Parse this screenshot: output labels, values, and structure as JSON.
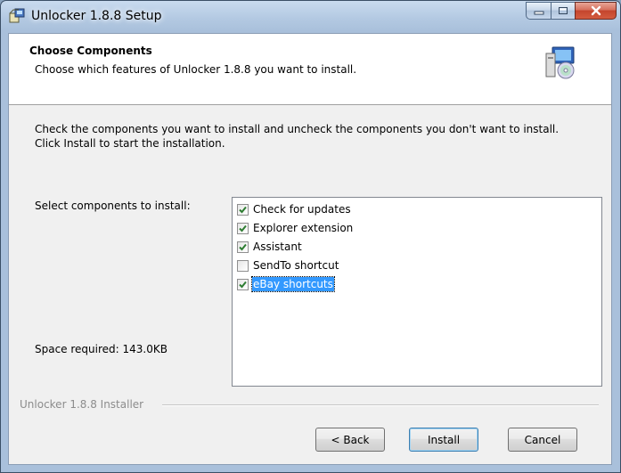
{
  "window": {
    "title": "Unlocker 1.8.8 Setup"
  },
  "header": {
    "title": "Choose Components",
    "subtitle": "Choose which features of Unlocker 1.8.8 you want to install."
  },
  "body": {
    "intro": "Check the components you want to install and uncheck the components you don't want to install. Click Install to start the installation.",
    "select_label": "Select components to install:",
    "space_label": "Space required: 143.0KB"
  },
  "components": [
    {
      "label": "Check for updates",
      "checked": true,
      "selected": false
    },
    {
      "label": "Explorer extension",
      "checked": true,
      "selected": false
    },
    {
      "label": "Assistant",
      "checked": true,
      "selected": false
    },
    {
      "label": "SendTo shortcut",
      "checked": false,
      "selected": false
    },
    {
      "label": "eBay shortcuts",
      "checked": true,
      "selected": true
    }
  ],
  "footer": {
    "branding": "Unlocker 1.8.8 Installer",
    "back_label": "< Back",
    "install_label": "Install",
    "cancel_label": "Cancel"
  },
  "colors": {
    "selection": "#3399ff",
    "check_mark": "#2e7d32"
  },
  "icons": {
    "app": "installer-box-icon",
    "header": "computer-cd-icon",
    "minimize": "minimize-icon",
    "maximize": "maximize-icon",
    "close": "close-icon"
  }
}
